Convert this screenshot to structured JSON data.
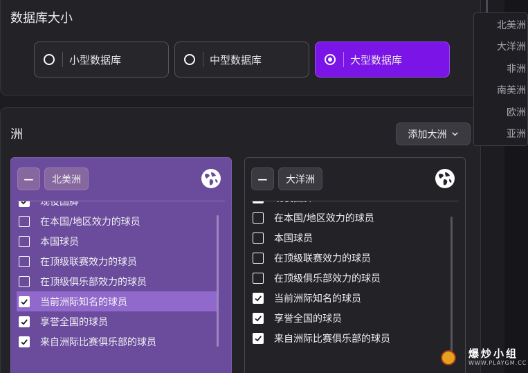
{
  "size_section": {
    "title": "数据库大小",
    "options": [
      {
        "label": "小型数据库",
        "selected": false
      },
      {
        "label": "中型数据库",
        "selected": false
      },
      {
        "label": "大型数据库",
        "selected": true
      }
    ]
  },
  "continent_section": {
    "title": "洲",
    "add_button_label": "添加大洲",
    "cards": [
      {
        "name": "北美洲",
        "minus_label": "−",
        "items": [
          {
            "label": "现役国脚",
            "checked": true
          },
          {
            "label": "在本国/地区效力的球员",
            "checked": false
          },
          {
            "label": "本国球员",
            "checked": false
          },
          {
            "label": "在顶级联赛效力的球员",
            "checked": false
          },
          {
            "label": "在顶级俱乐部效力的球员",
            "checked": false
          },
          {
            "label": "当前洲际知名的球员",
            "checked": true,
            "highlighted": true
          },
          {
            "label": "享誉全国的球员",
            "checked": true
          },
          {
            "label": "来自洲际比赛俱乐部的球员",
            "checked": true
          }
        ]
      },
      {
        "name": "大洋洲",
        "minus_label": "−",
        "items": [
          {
            "label": "现役国脚",
            "checked": true
          },
          {
            "label": "在本国/地区效力的球员",
            "checked": false
          },
          {
            "label": "本国球员",
            "checked": false
          },
          {
            "label": "在顶级联赛效力的球员",
            "checked": false
          },
          {
            "label": "在顶级俱乐部效力的球员",
            "checked": false
          },
          {
            "label": "当前洲际知名的球员",
            "checked": true
          },
          {
            "label": "享誉全国的球员",
            "checked": true
          },
          {
            "label": "来自洲际比赛俱乐部的球员",
            "checked": true
          }
        ]
      }
    ]
  },
  "dropdown": {
    "items": [
      "北美洲",
      "大洋洲",
      "非洲",
      "南美洲",
      "欧洲",
      "亚洲"
    ]
  },
  "watermark": {
    "title": "爆炒小组",
    "url": "WWW.PLAYGM.CC"
  },
  "colors": {
    "accent": "#7b14e6",
    "selected_card": "#6a4b9c",
    "highlight_row": "#9169cc",
    "background": "#1c1c21"
  }
}
